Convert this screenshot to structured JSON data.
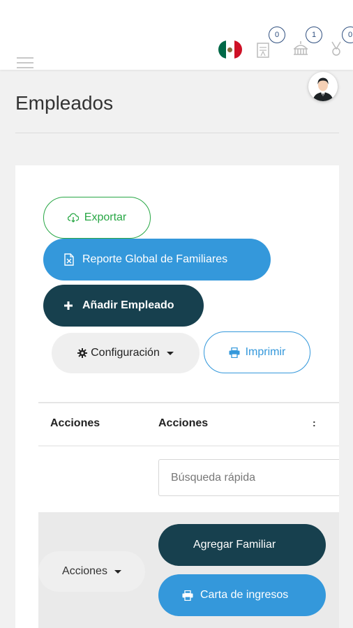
{
  "header": {
    "notifications": [
      {
        "icon": "document-icon",
        "count": "0"
      },
      {
        "icon": "building-icon",
        "count": "1"
      },
      {
        "icon": "award-icon",
        "count": "0"
      }
    ]
  },
  "page": {
    "title": "Empleados"
  },
  "toolbar": {
    "export_label": "Exportar",
    "report_label": "Reporte Global de Familiares",
    "add_label": "Añadir Empleado",
    "config_label": "Configuración",
    "print_label": "Imprimir"
  },
  "table": {
    "headers": [
      "Acciones",
      "Acciones",
      ":"
    ],
    "search_placeholder": "Búsqueda rápida",
    "row": {
      "actions_label": "Acciones",
      "add_family_label": "Agregar Familiar",
      "income_letter_label": "Carta de ingresos"
    }
  },
  "colors": {
    "primary_blue": "#3498db",
    "dark_teal": "#17404e",
    "green": "#28a745",
    "badge_border": "#2f4f7f"
  }
}
